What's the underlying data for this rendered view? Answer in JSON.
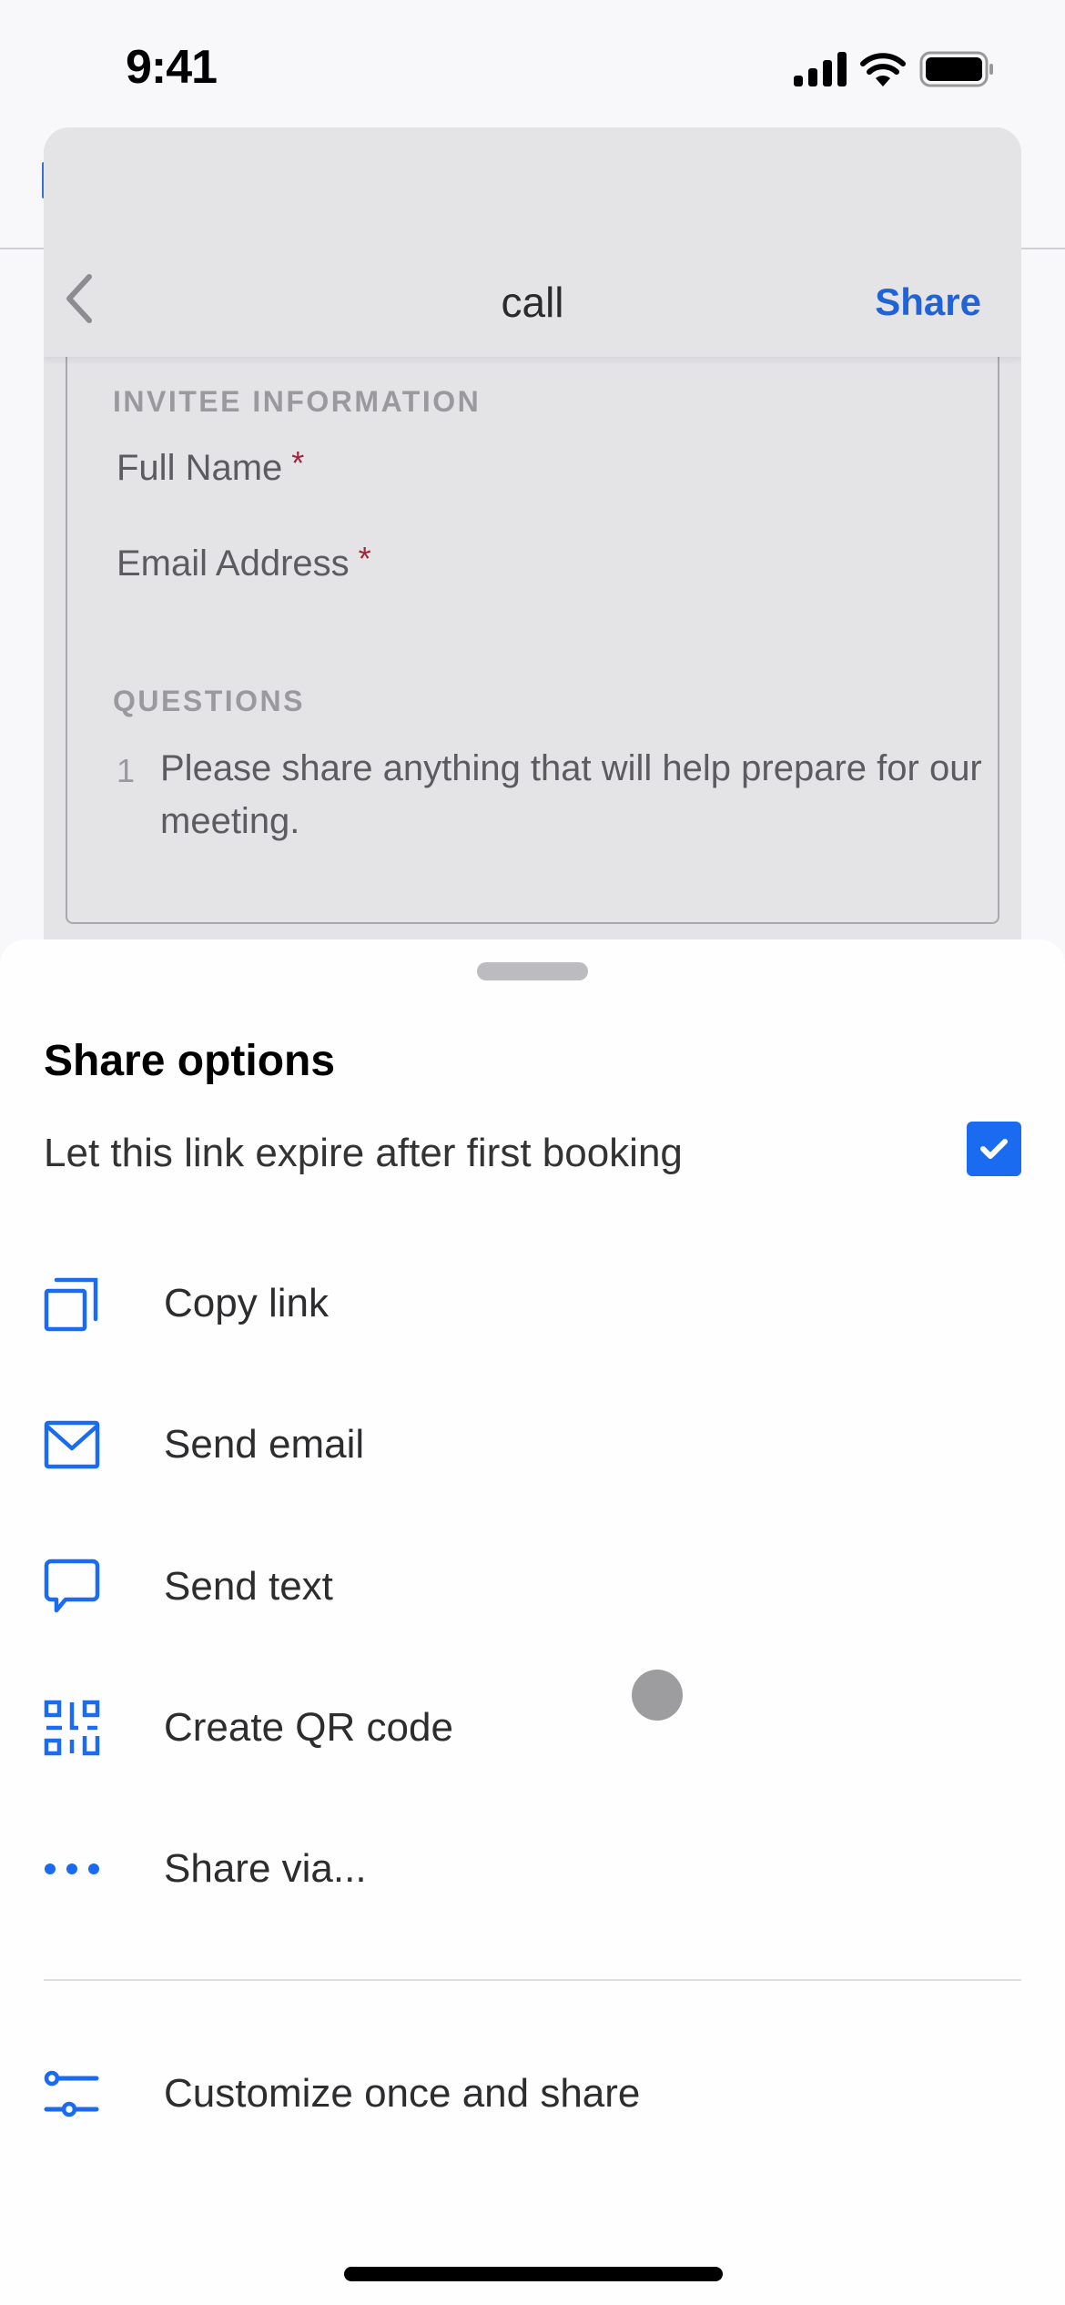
{
  "status_bar": {
    "time": "9:41"
  },
  "modal": {
    "title": "call",
    "share_label": "Share",
    "sections": {
      "invitee_heading": "INVITEE INFORMATION",
      "fields": [
        {
          "label": "Full Name",
          "required_mark": "*"
        },
        {
          "label": "Email Address",
          "required_mark": "*"
        }
      ],
      "questions_heading": "QUESTIONS",
      "questions": [
        {
          "number": "1",
          "text": "Please share anything that will help prepare for our meeting."
        }
      ]
    }
  },
  "sheet": {
    "title": "Share options",
    "expire_label": "Let this link expire after first booking",
    "expire_checked": true,
    "options": [
      {
        "icon": "copy-icon",
        "label": "Copy link"
      },
      {
        "icon": "mail-icon",
        "label": "Send email"
      },
      {
        "icon": "message-icon",
        "label": "Send text"
      },
      {
        "icon": "qr-code-icon",
        "label": "Create QR code"
      },
      {
        "icon": "more-horizontal-icon",
        "label": "Share via..."
      }
    ],
    "customize_label": "Customize once and share"
  },
  "colors": {
    "accent": "#1a6bf0",
    "link": "#1f63d6",
    "required": "#a3253b"
  }
}
